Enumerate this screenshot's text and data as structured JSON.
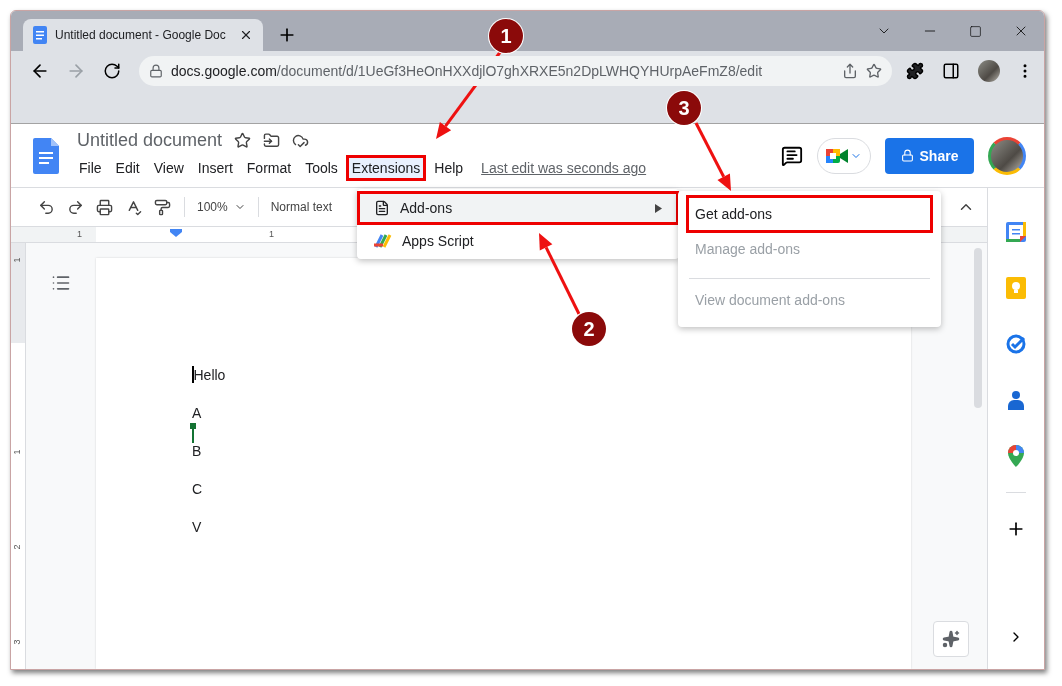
{
  "browser": {
    "tab": {
      "title": "Untitled document - Google Doc"
    },
    "address": {
      "domain": "docs.google.com",
      "path": "/document/d/1UeGf3HeOnHXXdjlO7ghXRXE5n2DpLWHQYHUrpAeFmZ8/edit"
    }
  },
  "document": {
    "title": "Untitled document",
    "last_edit": "Last edit was seconds ago",
    "share": "Share",
    "menu": [
      {
        "label": "File",
        "selected": false,
        "boxed": false
      },
      {
        "label": "Edit",
        "selected": false,
        "boxed": false
      },
      {
        "label": "View",
        "selected": false,
        "boxed": false
      },
      {
        "label": "Insert",
        "selected": false,
        "boxed": false
      },
      {
        "label": "Format",
        "selected": false,
        "boxed": false
      },
      {
        "label": "Tools",
        "selected": false,
        "boxed": false
      },
      {
        "label": "Extensions",
        "selected": true,
        "boxed": true
      },
      {
        "label": "Help",
        "selected": false,
        "boxed": false
      }
    ]
  },
  "toolbar": {
    "zoom": "100%",
    "style": "Normal text"
  },
  "rulers": {
    "horizontal": [
      "1",
      "1"
    ],
    "vertical": [
      "1",
      "1",
      "2",
      "3"
    ]
  },
  "page": {
    "lines": [
      "Hello",
      "A",
      "B",
      "C",
      "V"
    ]
  },
  "extensions_menu": [
    {
      "label": "Add-ons",
      "selected": true,
      "boxed": true,
      "submenu": true
    },
    {
      "label": "Apps Script",
      "selected": false,
      "boxed": false,
      "submenu": false
    }
  ],
  "addons_submenu": [
    {
      "label": "Get add-ons",
      "disabled": false,
      "boxed": true,
      "divider_before": false
    },
    {
      "label": "Manage add-ons",
      "disabled": true,
      "boxed": false,
      "divider_before": false
    },
    {
      "label": "View document add-ons",
      "disabled": true,
      "boxed": false,
      "divider_before": true
    }
  ],
  "annotations": [
    {
      "label": "1"
    },
    {
      "label": "2"
    },
    {
      "label": "3"
    }
  ]
}
